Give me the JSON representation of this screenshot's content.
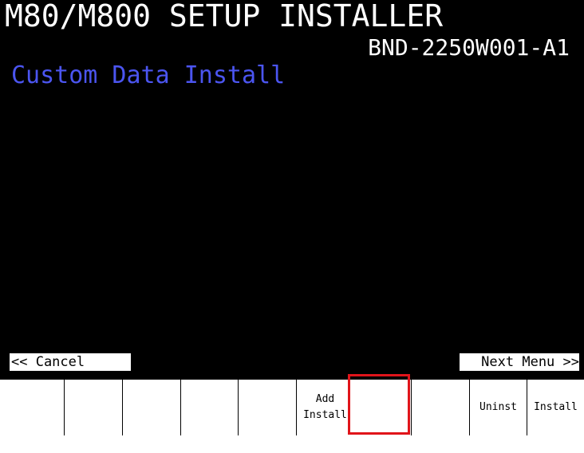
{
  "app": {
    "title": "M80/M800 SETUP INSTALLER",
    "version": "BND-2250W001-A1",
    "subtitle": "Custom Data Install",
    "subtitle_color": "#4b55f0"
  },
  "nav": {
    "cancel_label": "<< Cancel",
    "next_label": "Next Menu >>"
  },
  "softkeys": [
    {
      "line1": "",
      "line2": ""
    },
    {
      "line1": "",
      "line2": ""
    },
    {
      "line1": "",
      "line2": ""
    },
    {
      "line1": "",
      "line2": ""
    },
    {
      "line1": "",
      "line2": ""
    },
    {
      "line1": "Add",
      "line2": "Install",
      "highlighted": true
    },
    {
      "line1": "",
      "line2": ""
    },
    {
      "line1": "Uninst",
      "line2": ""
    },
    {
      "line1": "Install",
      "line2": ""
    }
  ],
  "highlight_color": "#e0141a"
}
